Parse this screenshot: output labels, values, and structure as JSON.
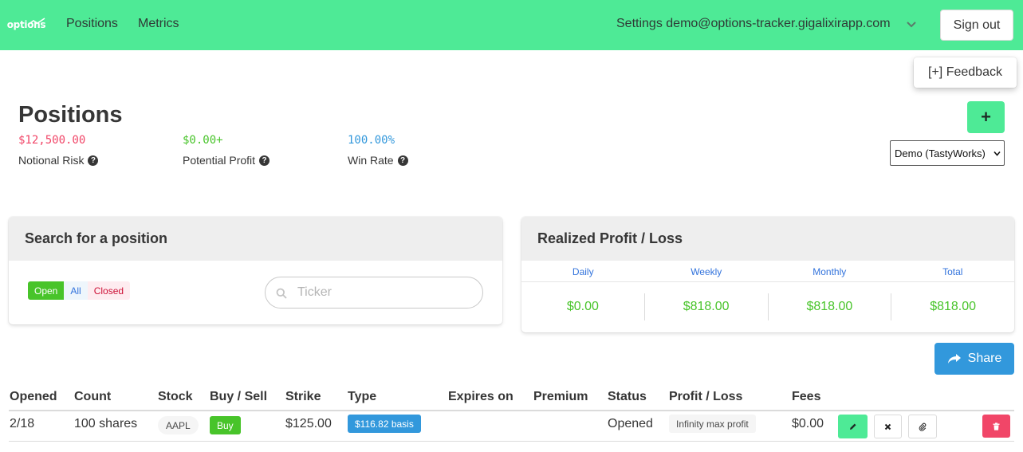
{
  "nav": {
    "logo_text": "options",
    "links": [
      "Positions",
      "Metrics"
    ],
    "settings_label": "Settings",
    "user_email": "demo@options-tracker.gigalixirapp.com",
    "sign_out_label": "Sign out"
  },
  "feedback_label": "[+] Feedback",
  "page": {
    "title": "Positions",
    "stats": [
      {
        "value": "$12,500.00",
        "label": "Notional Risk",
        "color": "#f14668"
      },
      {
        "value": "$0.00+",
        "label": "Potential Profit",
        "color": "#48c42a"
      },
      {
        "value": "100.00%",
        "label": "Win Rate",
        "color": "#3298dc"
      }
    ],
    "add_button_label": "+",
    "account_selected": "Demo (TastyWorks)"
  },
  "search_card": {
    "title": "Search for a position",
    "filters": {
      "open": "Open",
      "all": "All",
      "closed": "Closed"
    },
    "search_placeholder": "Ticker"
  },
  "pl_card": {
    "title": "Realized Profit / Loss",
    "periods": [
      {
        "label": "Daily",
        "value": "$0.00"
      },
      {
        "label": "Weekly",
        "value": "$818.00"
      },
      {
        "label": "Monthly",
        "value": "$818.00"
      },
      {
        "label": "Total",
        "value": "$818.00"
      }
    ]
  },
  "share_label": "Share",
  "table": {
    "headers": [
      "Opened",
      "Count",
      "Stock",
      "Buy / Sell",
      "Strike",
      "Type",
      "Expires on",
      "Premium",
      "Status",
      "Profit / Loss",
      "Fees"
    ],
    "rows": [
      {
        "opened": "2/18",
        "count": "100 shares",
        "stock": "AAPL",
        "side": "Buy",
        "strike": "$125.00",
        "type": "$116.82 basis",
        "expires": "",
        "premium": "",
        "status": "Opened",
        "profit_loss": "Infinity max profit",
        "fees": "$0.00"
      }
    ]
  },
  "icons": {
    "logo": "chart-line-icon",
    "chevron": "chevron-down-icon",
    "help": "question-circle-icon",
    "search": "search-icon",
    "share": "share-arrow-icon",
    "edit": "pencil-icon",
    "close": "close-icon",
    "attach": "paperclip-icon",
    "delete": "trash-icon"
  },
  "colors": {
    "brand_green": "#4eea96",
    "success": "#48c42a",
    "info": "#3298dc",
    "danger": "#f14668"
  }
}
